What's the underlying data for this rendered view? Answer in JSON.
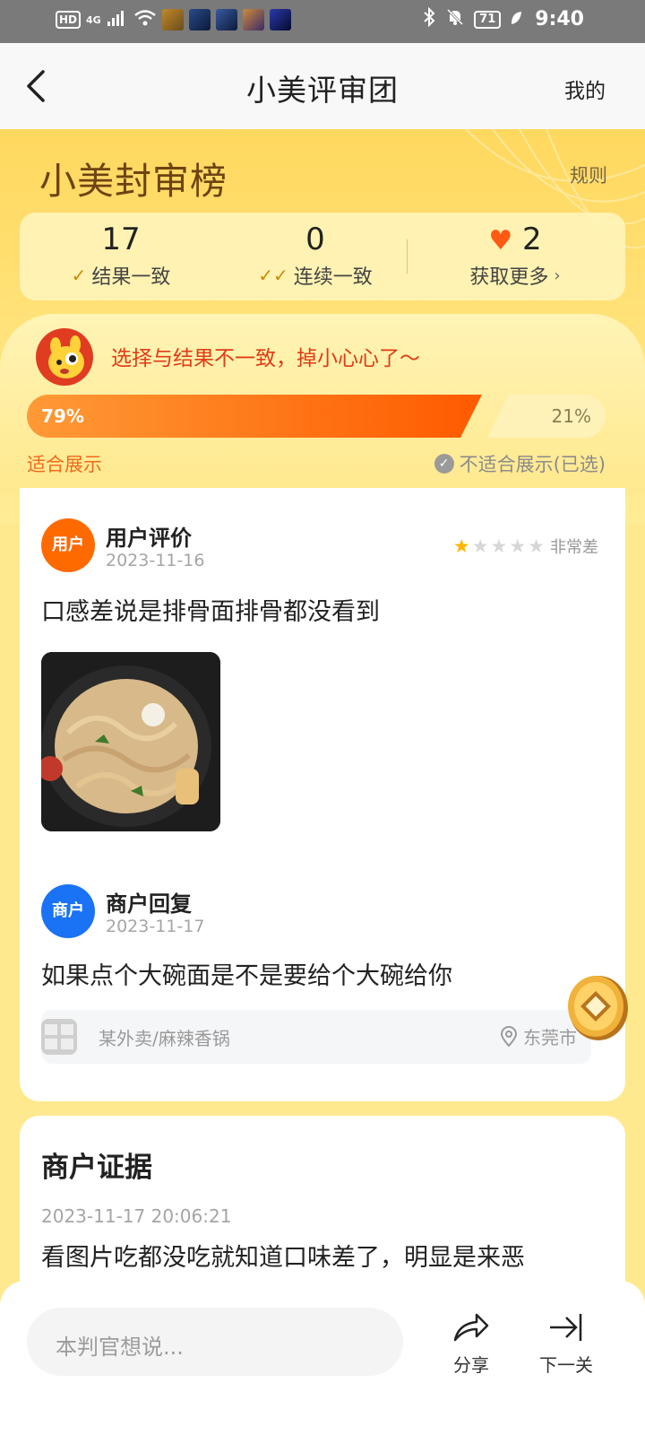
{
  "status_bar": {
    "left_indicators": [
      "HD",
      "4G"
    ],
    "battery": "71",
    "time": "9:40"
  },
  "nav": {
    "title": "小美评审团",
    "right_link": "我的"
  },
  "header": {
    "brand": "小美封审榜",
    "rules": "规则"
  },
  "stats": {
    "consistent_count": "17",
    "consistent_label": "结果一致",
    "streak_count": "0",
    "streak_label": "连续一致",
    "hearts": "2",
    "more_label": "获取更多"
  },
  "alert": {
    "text": "选择与结果不一致，掉小心心了～"
  },
  "vote": {
    "left_percent_text": "79%",
    "right_percent_text": "21%",
    "left_fraction": 0.79,
    "left_option": "适合展示",
    "right_option": "不适合展示(已选)"
  },
  "review": {
    "avatar_label": "用户",
    "title": "用户评价",
    "date": "2023-11-16",
    "rating": 1,
    "rating_max": 5,
    "rating_label": "非常差",
    "text": "口感差说是排骨面排骨都没看到"
  },
  "reply": {
    "avatar_label": "商户",
    "title": "商户回复",
    "date": "2023-11-17",
    "text": "如果点个大碗面是不是要给个大碗给你"
  },
  "shop": {
    "name": "某外卖/麻辣香锅",
    "city": "东莞市"
  },
  "evidence": {
    "title": "商户证据",
    "time": "2023-11-17 20:06:21",
    "text": "看图片吃都没吃就知道口味差了，明显是来恶"
  },
  "bottom": {
    "comment_placeholder": "本判官想说...",
    "share_label": "分享",
    "next_label": "下一关"
  },
  "colors": {
    "accent_orange": "#ff5a00",
    "alert_red": "#e23b16",
    "hero_yellow": "#ffd85e",
    "biz_blue": "#1a73f5"
  }
}
